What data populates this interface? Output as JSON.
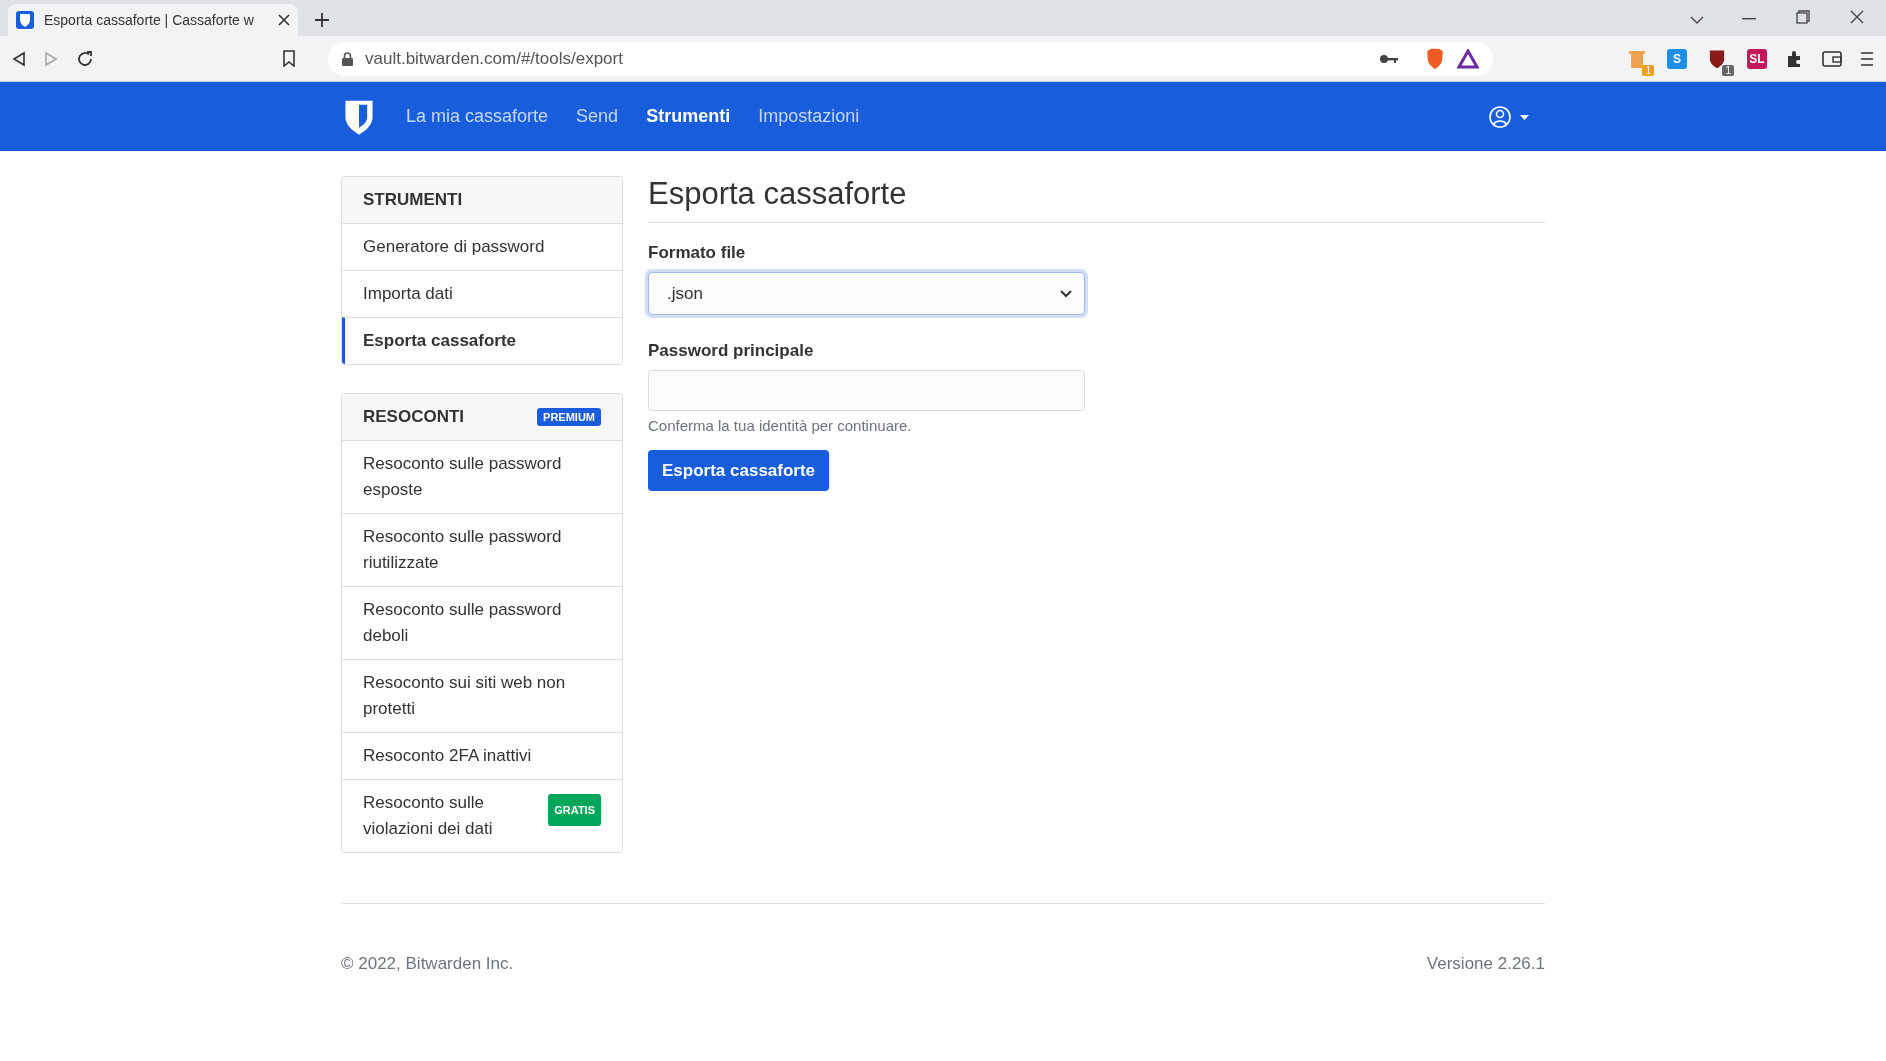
{
  "browser": {
    "tab": {
      "title": "Esporta cassaforte | Cassaforte w"
    },
    "url": "vault.bitwarden.com/#/tools/export",
    "extensions": [
      {
        "kind": "trash",
        "badge": "1"
      },
      {
        "kind": "letter",
        "label": "S"
      },
      {
        "kind": "shield",
        "badge": "1"
      },
      {
        "kind": "letter",
        "label": "SL"
      }
    ]
  },
  "nav": {
    "items": [
      {
        "label": "La mia cassaforte",
        "selected": false
      },
      {
        "label": "Send",
        "selected": false
      },
      {
        "label": "Strumenti",
        "selected": true
      },
      {
        "label": "Impostazioni",
        "selected": false
      }
    ]
  },
  "sidebar": [
    {
      "title": "STRUMENTI",
      "items": [
        {
          "label": "Generatore di password",
          "selected": false
        },
        {
          "label": "Importa dati",
          "selected": false
        },
        {
          "label": "Esporta cassaforte",
          "selected": true
        }
      ]
    },
    {
      "title": "RESOCONTI",
      "badge": {
        "text": "PREMIUM",
        "color": "#175ddc"
      },
      "items": [
        {
          "label": "Resoconto sulle password esposte",
          "selected": false
        },
        {
          "label": "Resoconto sulle password riutilizzate",
          "selected": false
        },
        {
          "label": "Resoconto sulle password deboli",
          "selected": false
        },
        {
          "label": "Resoconto sui siti web non protetti",
          "selected": false
        },
        {
          "label": "Resoconto 2FA inattivi",
          "selected": false
        },
        {
          "label": "Resoconto sulle violazioni dei dati",
          "selected": false,
          "badge": {
            "text": "GRATIS",
            "color": "#00a65a"
          }
        }
      ]
    }
  ],
  "main": {
    "title": "Esporta cassaforte",
    "format_label": "Formato file",
    "format_value": ".json",
    "password_label": "Password principale",
    "password_hint": "Conferma la tua identità per continuare.",
    "button": "Esporta cassaforte"
  },
  "footer": {
    "copyright": "© 2022, Bitwarden Inc.",
    "version": "Versione 2.26.1"
  }
}
